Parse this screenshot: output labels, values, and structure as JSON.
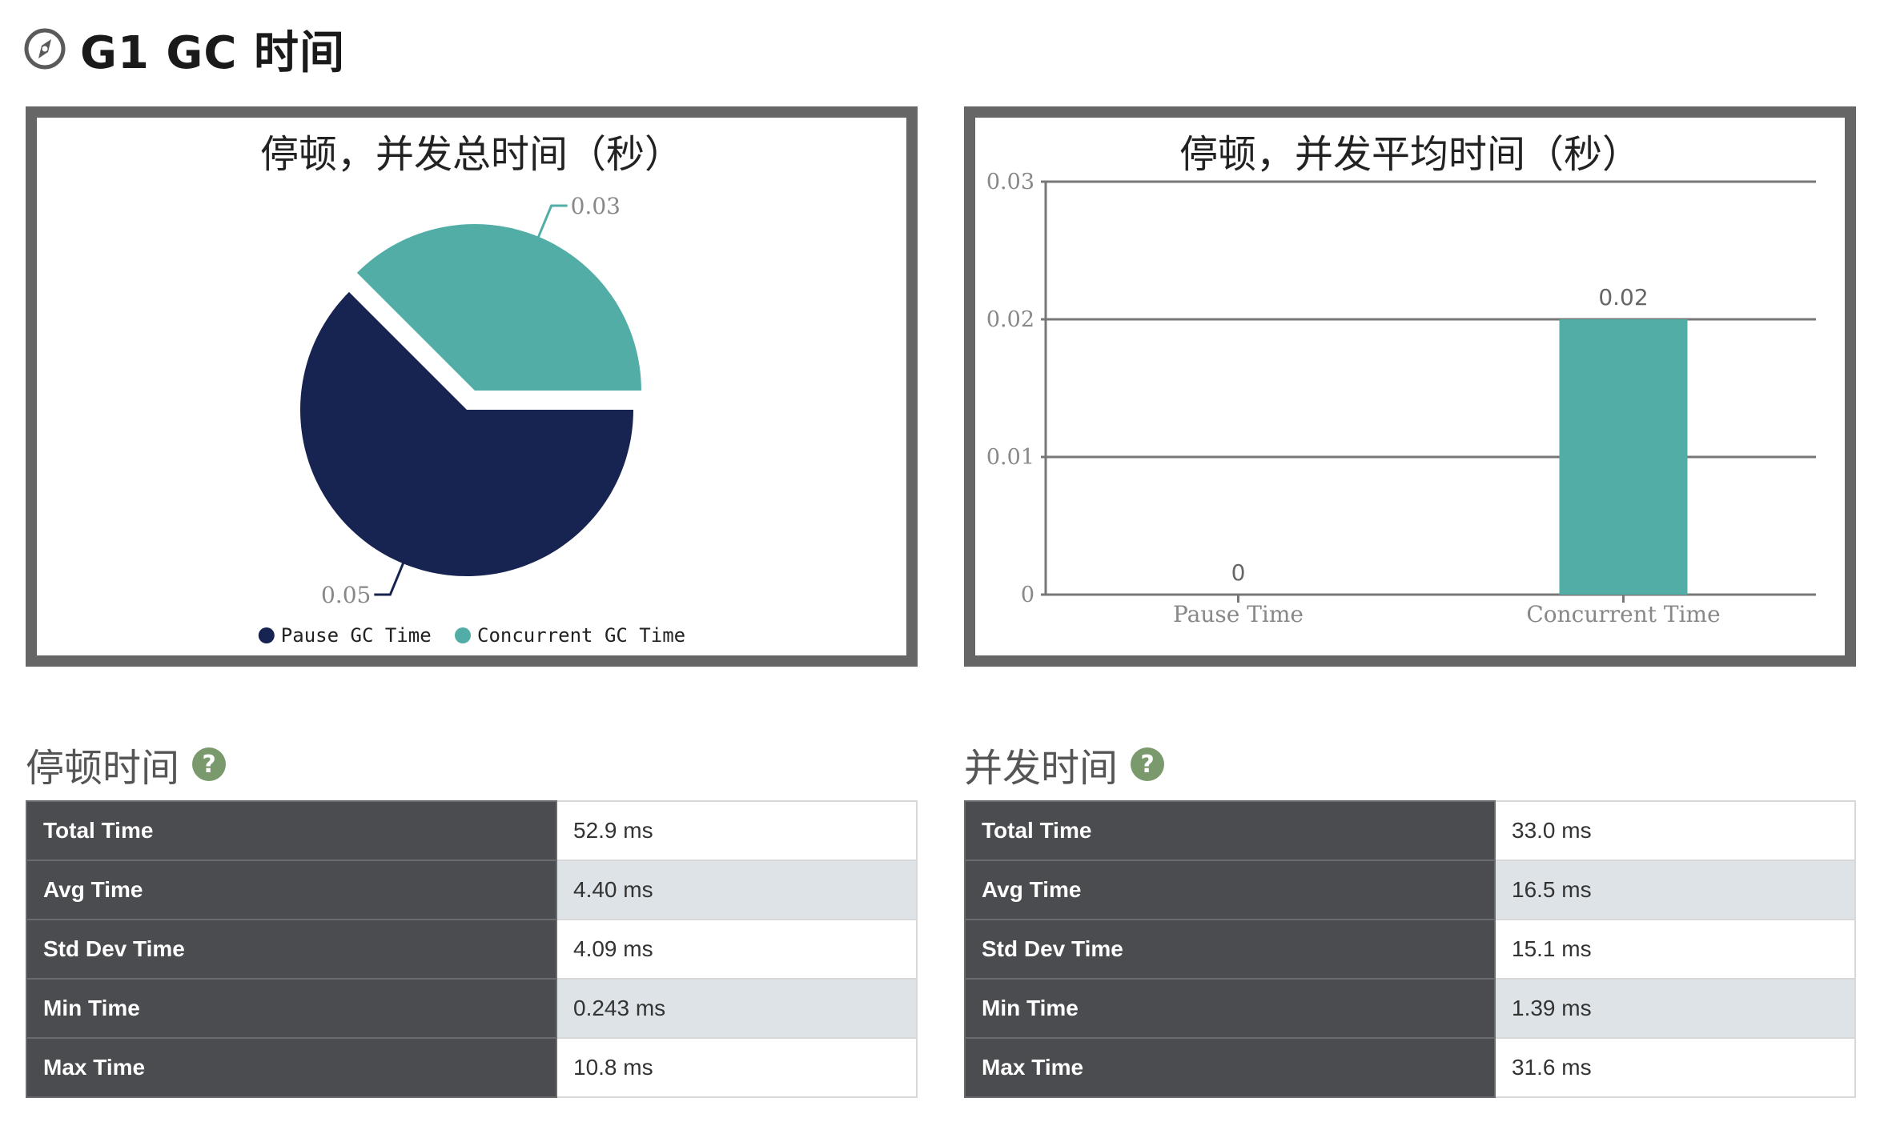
{
  "page": {
    "title": "G1 GC 时间",
    "title_icon": "compass-icon"
  },
  "colors": {
    "pause": "#172451",
    "concurrent": "#52ada6",
    "frame": "#666666",
    "table_label_bg": "#4b4c50",
    "table_alt_row": "#dde3e6",
    "help_icon": "#7a9a6e"
  },
  "chart_data": [
    {
      "type": "pie",
      "title": "停顿，并发总时间（秒）",
      "slices": [
        {
          "name": "Pause GC Time",
          "value": 0.05,
          "label": "0.05",
          "color": "#172451"
        },
        {
          "name": "Concurrent GC Time",
          "value": 0.03,
          "label": "0.03",
          "color": "#52ada6"
        }
      ],
      "legend": [
        "Pause GC Time",
        "Concurrent GC Time"
      ],
      "legend_position": "bottom"
    },
    {
      "type": "bar",
      "title": "停顿，并发平均时间（秒）",
      "categories": [
        "Pause Time",
        "Concurrent Time"
      ],
      "values": [
        0,
        0.02
      ],
      "labels": [
        "0",
        "0.02"
      ],
      "ylim": [
        0,
        0.03
      ],
      "yticks": [
        "0",
        "0.01",
        "0.02",
        "0.03"
      ],
      "grid": true,
      "color": "#52ada6"
    }
  ],
  "pause_section": {
    "title": "停顿时间",
    "rows": [
      {
        "label": "Total Time",
        "value": "52.9 ms"
      },
      {
        "label": "Avg Time",
        "value": "4.40 ms"
      },
      {
        "label": "Std Dev Time",
        "value": "4.09 ms"
      },
      {
        "label": "Min Time",
        "value": "0.243 ms"
      },
      {
        "label": "Max Time",
        "value": "10.8 ms"
      }
    ]
  },
  "concurrent_section": {
    "title": "并发时间",
    "rows": [
      {
        "label": "Total Time",
        "value": "33.0 ms"
      },
      {
        "label": "Avg Time",
        "value": "16.5 ms"
      },
      {
        "label": "Std Dev Time",
        "value": "15.1 ms"
      },
      {
        "label": "Min Time",
        "value": "1.39 ms"
      },
      {
        "label": "Max Time",
        "value": "31.6 ms"
      }
    ]
  },
  "help_glyph": "?"
}
